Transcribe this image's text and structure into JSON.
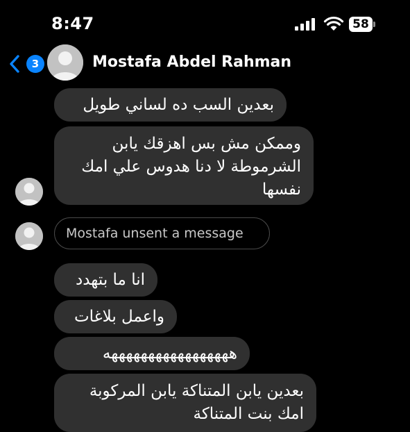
{
  "status_bar": {
    "time": "8:47",
    "battery": "58",
    "icons": [
      "signal-icon",
      "wifi-icon",
      "battery-icon"
    ]
  },
  "header": {
    "back_badge_count": "3",
    "contact_name": "Mostafa Abdel Rahman",
    "accent_color": "#0a84ff"
  },
  "messages": [
    {
      "text": "بعدين السب ده لساني طويل"
    },
    {
      "text": "وممكن مش بس اهزقك يابن\nالشرموطة لا دنا هدوس علي امك\nنفسها"
    },
    {
      "text": "Mostafa unsent a message",
      "unsent": true
    },
    {
      "text": "انا ما بتهدد"
    },
    {
      "text": "واعمل بلاغات"
    },
    {
      "text": "هههههههههههههههههه"
    },
    {
      "text": "بعدين يابن المتناكة يابن المركوبة\nامك بنت المتناكة"
    }
  ],
  "colors": {
    "background": "#000000",
    "bubble": "#303030",
    "unsent_border": "#4a4a4a"
  }
}
